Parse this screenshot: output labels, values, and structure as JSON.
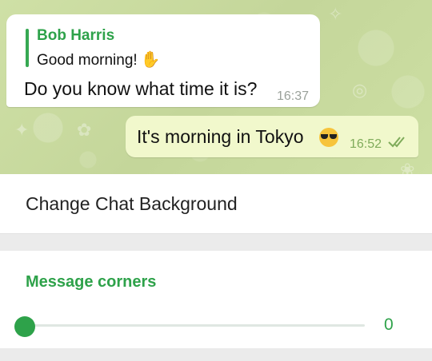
{
  "chat_preview": {
    "incoming": {
      "reply_name": "Bob Harris",
      "reply_text": "Good morning!",
      "text": "Do you know what time it is?",
      "time": "16:37"
    },
    "outgoing": {
      "text": "It's morning in Tokyo",
      "time": "16:52",
      "status_icon": "double-check-icon"
    }
  },
  "settings": {
    "change_background_label": "Change Chat Background",
    "message_corners_title": "Message corners",
    "corner_slider_value": "0"
  },
  "colors": {
    "accent": "#2ea24a",
    "chat_background": "#c8d9a0",
    "outgoing_bubble": "#f1f8cc",
    "incoming_bubble": "#ffffff"
  }
}
